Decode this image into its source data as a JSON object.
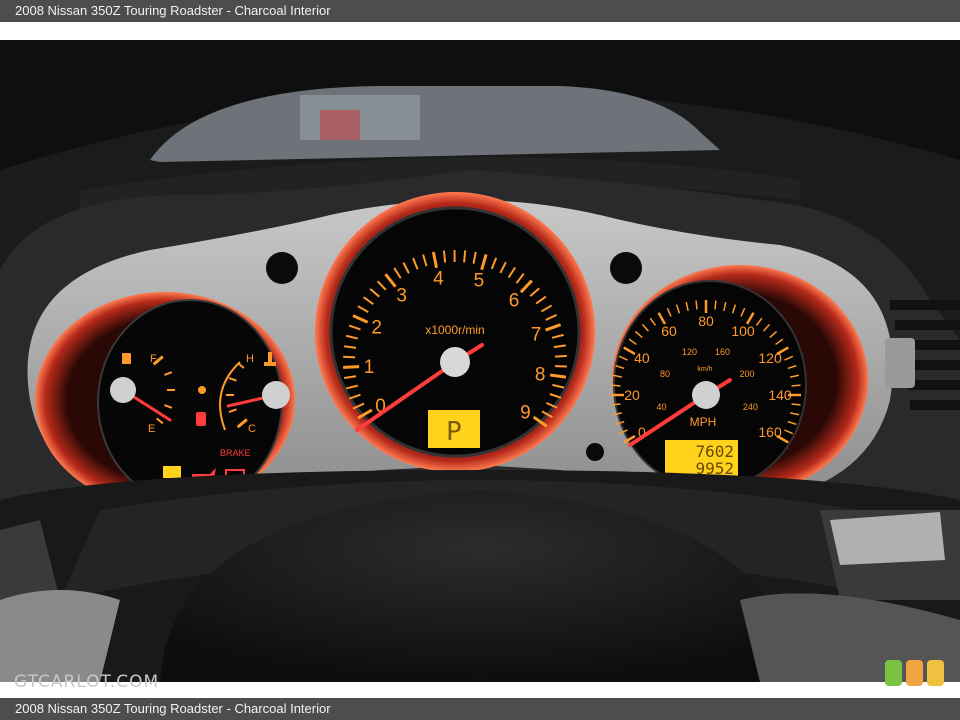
{
  "caption": {
    "top": "2008 Nissan 350Z Touring Roadster - Charcoal Interior",
    "bottom": "2008 Nissan 350Z Touring Roadster - Charcoal Interior"
  },
  "watermark": "GTCARLOT.COM",
  "badge_colors": [
    "#7cc242",
    "#f0a541",
    "#f0c040"
  ],
  "tachometer": {
    "unit": "x1000r/min",
    "labels": [
      "0",
      "1",
      "2",
      "3",
      "4",
      "5",
      "6",
      "7",
      "8",
      "9"
    ],
    "gear_display": "P"
  },
  "speedometer": {
    "unit": "MPH",
    "mph_labels": [
      "0",
      "20",
      "40",
      "60",
      "80",
      "100",
      "120",
      "140",
      "160"
    ],
    "kmh_unit": "km/h",
    "kmh_labels": [
      "40",
      "80",
      "120",
      "160",
      "200",
      "240"
    ],
    "odometer": "7602",
    "trip": "9952"
  },
  "left_gauges": {
    "fuel_full": "F",
    "fuel_empty": "E",
    "temp_hot": "H",
    "temp_cold": "C",
    "brake_warning": "BRAKE"
  },
  "colors": {
    "gauge_orange": "#ff9a2a",
    "needle_red": "#ff3b3b",
    "lcd_yellow": "#ffd21c"
  }
}
